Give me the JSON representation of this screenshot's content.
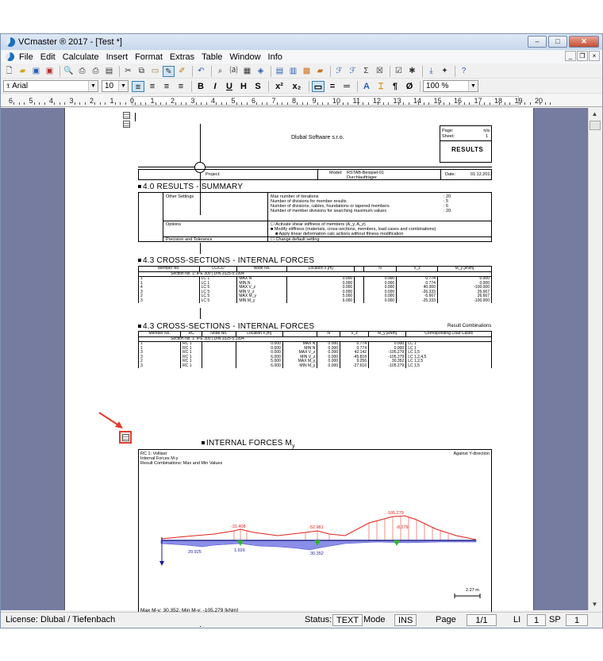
{
  "window": {
    "title": "VCmaster ® 2017 - [Test *]",
    "buttons": [
      "–",
      "□",
      "✕"
    ]
  },
  "menu": [
    "File",
    "Edit",
    "Calculate",
    "Insert",
    "Format",
    "Extras",
    "Table",
    "Window",
    "Info"
  ],
  "format_bar": {
    "font": "Arial",
    "size": "10",
    "bold": "B",
    "italic": "I",
    "underline": "U",
    "h": "H",
    "s": "S",
    "superscript": "x²",
    "subscript": "x₂",
    "zoom": "100 %",
    "para": "¶",
    "slash": "Ø"
  },
  "ruler": {
    "labels": [
      "6",
      "5",
      "4",
      "3",
      "2",
      "1",
      "0",
      "1",
      "2",
      "3",
      "4",
      "5",
      "6",
      "7",
      "8",
      "9",
      "10",
      "11",
      "12",
      "13",
      "14",
      "15",
      "16",
      "17",
      "18",
      "19",
      "20"
    ]
  },
  "header": {
    "company": "Dlubal Software s.r.o.",
    "page_label": "Page:",
    "page_value": "n/a",
    "sheet_label": "Sheet:",
    "sheet_value": "1",
    "results": "RESULTS",
    "project_label": "Project:",
    "model_label": "Model:",
    "model_value": "RSTAB-Beispiel-01",
    "model_sub": "Durchlaufträger",
    "date_label": "Date:",
    "date_value": "01.12.2017"
  },
  "summary": {
    "heading": "4.0 RESULTS - SUMMARY",
    "rows": [
      {
        "left": "Other Settings",
        "items": [
          "Max number of iterations",
          "Number of divisions for member results",
          "Number of divisions, cables, foundations or tapered members",
          "Number of member divisions for searching maximum values"
        ],
        "values": [
          ": 20",
          ": 5",
          ": 6",
          ": 20"
        ]
      },
      {
        "left": "Options",
        "items": [
          "☐ Activate shear stiffness of members (A_y, A_z)",
          "■ Modify stiffness (materials, cross-sections, members, load cases and combinations)",
          "■ Apply linear deformation calc actions without fitness modification"
        ],
        "values": []
      },
      {
        "left": "Precision and Tolerance",
        "items": [
          "☐ Change default setting"
        ],
        "values": []
      }
    ]
  },
  "t1": {
    "heading": "4.3 CROSS-SECTIONS - INTERNAL FORCES",
    "headers": [
      "Member No.",
      "LC/CO",
      "Node No.",
      "Location x [m]",
      "",
      "N",
      "V_z",
      "M_y [kNm]"
    ],
    "group": "Section No. 1: IPE 300 | DIN 1025-5:1994",
    "rows": [
      [
        "1",
        "LC 1",
        "MAX N",
        "0.000",
        "",
        "0.000",
        "0.774",
        "0.000"
      ],
      [
        "1",
        "LC 1",
        "MIN N",
        "0.000",
        "",
        "0.000",
        "0.774",
        "0.000"
      ],
      [
        "4",
        "LC 5",
        "MAX V_z",
        "0.000",
        "",
        "0.000",
        "40.000",
        "-100.000"
      ],
      [
        "3",
        "LC 5",
        "MIN V_z",
        "0.000",
        "",
        "0.000",
        "-26.333",
        "26.667"
      ],
      [
        "2",
        "LC 5",
        "MAX M_y",
        "5.000",
        "",
        "0.000",
        "-5.667",
        "26.667"
      ],
      [
        "3",
        "LC 5",
        "MIN M_y",
        "6.000",
        "",
        "0.000",
        "-25.333",
        "-100.000"
      ]
    ]
  },
  "t2": {
    "heading": "4.3 CROSS-SECTIONS - INTERNAL FORCES",
    "right": "Result Combinations",
    "headers": [
      "Member No.",
      "RC",
      "Node No.",
      "Location x [m]",
      "",
      "N",
      "V_z",
      "M_y [kNm]",
      "Corresponding Load Cases"
    ],
    "group": "Section No. 1: IPE 300 | DIN 1025-5:1994",
    "rows": [
      [
        "1",
        "RC 1",
        "",
        "0.000",
        "MAX N",
        "0.000",
        "0.774",
        "0.000",
        "LC 1"
      ],
      [
        "1",
        "RC 1",
        "",
        "0.000",
        "MIN N",
        "0.000",
        "0.774",
        "0.000",
        "LC 1"
      ],
      [
        "3",
        "RC 1",
        "",
        "0.000",
        "MAX V_z",
        "0.000",
        "42.142",
        "-105.279",
        "LC 1,5"
      ],
      [
        "3",
        "RC 1",
        "",
        "6.000",
        "MIN V_z",
        "0.000",
        "-45.818",
        "-105.279",
        "LC 1,2,4,5"
      ],
      [
        "2",
        "RC 1",
        "",
        "5.000",
        "MAX M_y",
        "0.000",
        "9.256",
        "30.352",
        "LC 1,2,5"
      ],
      [
        "3",
        "RC 1",
        "",
        "6.000",
        "MIN M_y",
        "0.000",
        "-27.616",
        "-105.279",
        "LC 1,5"
      ]
    ]
  },
  "figure": {
    "heading": "INTERNAL FORCES  M",
    "heading_sub": "y",
    "rc": "RC 1: Volllast",
    "direction": "Against Y-direction",
    "line2": "Internal Forces M-y",
    "line3": "Result Combinations: Max and Min Values",
    "footer": "Max M-y: 30.352, Min M-y: -105.279 [kNm]",
    "scale": "2.27 m",
    "values": {
      "v1": "-31.408",
      "v2": "-52.981",
      "v3": "-105.279",
      "v4": "-8.279",
      "v5": "20.925",
      "v6": "1.926",
      "v7": "30.352"
    }
  },
  "status": {
    "license": "License: Dlubal / Tiefenbach",
    "status_label": "Status:",
    "text": "TEXT",
    "mode": "Mode",
    "ins": "INS",
    "page_label": "Page",
    "page": "1/1",
    "li_label": "LI",
    "li": "1",
    "sp_label": "SP",
    "sp": "1"
  }
}
